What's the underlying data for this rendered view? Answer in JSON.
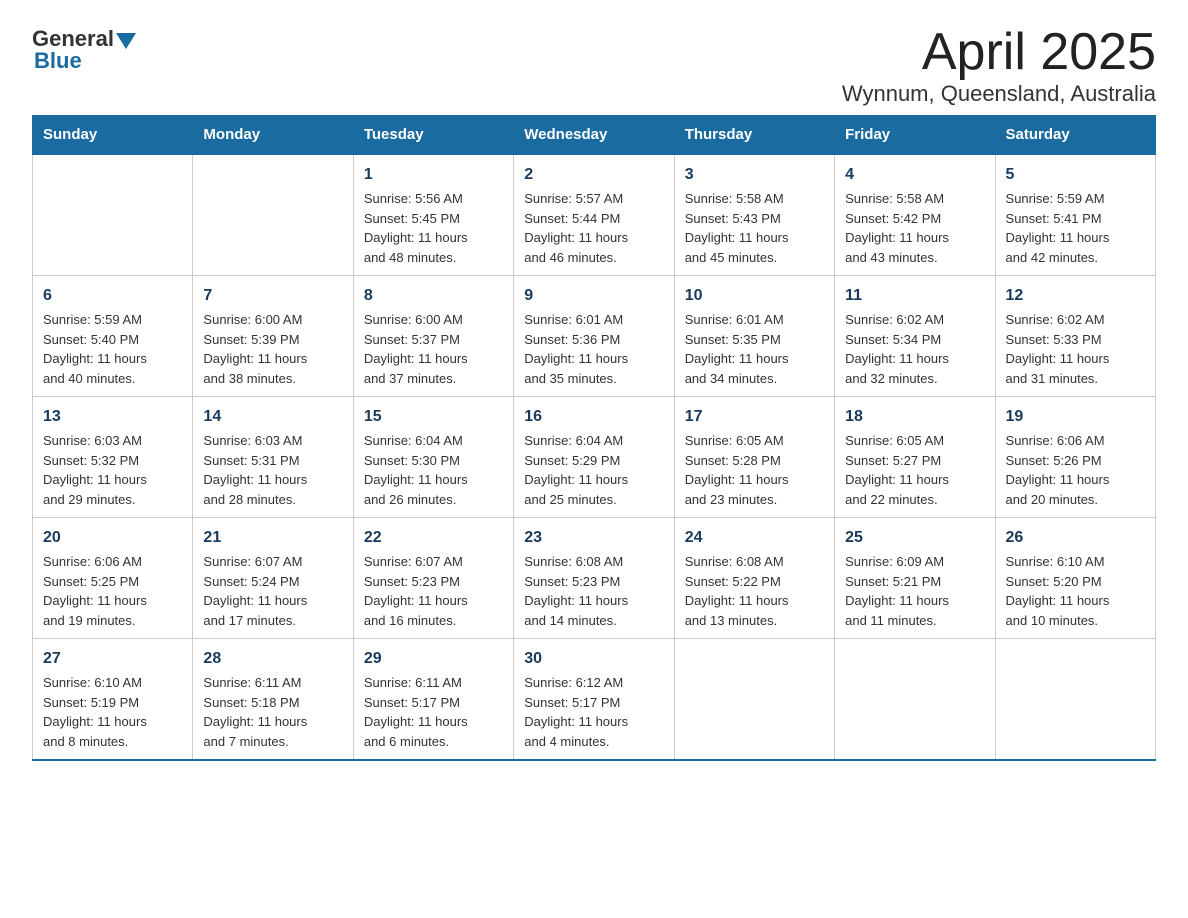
{
  "header": {
    "logo_general": "General",
    "logo_blue": "Blue",
    "title": "April 2025",
    "subtitle": "Wynnum, Queensland, Australia"
  },
  "days_of_week": [
    "Sunday",
    "Monday",
    "Tuesday",
    "Wednesday",
    "Thursday",
    "Friday",
    "Saturday"
  ],
  "weeks": [
    [
      {
        "day": "",
        "info": ""
      },
      {
        "day": "",
        "info": ""
      },
      {
        "day": "1",
        "info": "Sunrise: 5:56 AM\nSunset: 5:45 PM\nDaylight: 11 hours\nand 48 minutes."
      },
      {
        "day": "2",
        "info": "Sunrise: 5:57 AM\nSunset: 5:44 PM\nDaylight: 11 hours\nand 46 minutes."
      },
      {
        "day": "3",
        "info": "Sunrise: 5:58 AM\nSunset: 5:43 PM\nDaylight: 11 hours\nand 45 minutes."
      },
      {
        "day": "4",
        "info": "Sunrise: 5:58 AM\nSunset: 5:42 PM\nDaylight: 11 hours\nand 43 minutes."
      },
      {
        "day": "5",
        "info": "Sunrise: 5:59 AM\nSunset: 5:41 PM\nDaylight: 11 hours\nand 42 minutes."
      }
    ],
    [
      {
        "day": "6",
        "info": "Sunrise: 5:59 AM\nSunset: 5:40 PM\nDaylight: 11 hours\nand 40 minutes."
      },
      {
        "day": "7",
        "info": "Sunrise: 6:00 AM\nSunset: 5:39 PM\nDaylight: 11 hours\nand 38 minutes."
      },
      {
        "day": "8",
        "info": "Sunrise: 6:00 AM\nSunset: 5:37 PM\nDaylight: 11 hours\nand 37 minutes."
      },
      {
        "day": "9",
        "info": "Sunrise: 6:01 AM\nSunset: 5:36 PM\nDaylight: 11 hours\nand 35 minutes."
      },
      {
        "day": "10",
        "info": "Sunrise: 6:01 AM\nSunset: 5:35 PM\nDaylight: 11 hours\nand 34 minutes."
      },
      {
        "day": "11",
        "info": "Sunrise: 6:02 AM\nSunset: 5:34 PM\nDaylight: 11 hours\nand 32 minutes."
      },
      {
        "day": "12",
        "info": "Sunrise: 6:02 AM\nSunset: 5:33 PM\nDaylight: 11 hours\nand 31 minutes."
      }
    ],
    [
      {
        "day": "13",
        "info": "Sunrise: 6:03 AM\nSunset: 5:32 PM\nDaylight: 11 hours\nand 29 minutes."
      },
      {
        "day": "14",
        "info": "Sunrise: 6:03 AM\nSunset: 5:31 PM\nDaylight: 11 hours\nand 28 minutes."
      },
      {
        "day": "15",
        "info": "Sunrise: 6:04 AM\nSunset: 5:30 PM\nDaylight: 11 hours\nand 26 minutes."
      },
      {
        "day": "16",
        "info": "Sunrise: 6:04 AM\nSunset: 5:29 PM\nDaylight: 11 hours\nand 25 minutes."
      },
      {
        "day": "17",
        "info": "Sunrise: 6:05 AM\nSunset: 5:28 PM\nDaylight: 11 hours\nand 23 minutes."
      },
      {
        "day": "18",
        "info": "Sunrise: 6:05 AM\nSunset: 5:27 PM\nDaylight: 11 hours\nand 22 minutes."
      },
      {
        "day": "19",
        "info": "Sunrise: 6:06 AM\nSunset: 5:26 PM\nDaylight: 11 hours\nand 20 minutes."
      }
    ],
    [
      {
        "day": "20",
        "info": "Sunrise: 6:06 AM\nSunset: 5:25 PM\nDaylight: 11 hours\nand 19 minutes."
      },
      {
        "day": "21",
        "info": "Sunrise: 6:07 AM\nSunset: 5:24 PM\nDaylight: 11 hours\nand 17 minutes."
      },
      {
        "day": "22",
        "info": "Sunrise: 6:07 AM\nSunset: 5:23 PM\nDaylight: 11 hours\nand 16 minutes."
      },
      {
        "day": "23",
        "info": "Sunrise: 6:08 AM\nSunset: 5:23 PM\nDaylight: 11 hours\nand 14 minutes."
      },
      {
        "day": "24",
        "info": "Sunrise: 6:08 AM\nSunset: 5:22 PM\nDaylight: 11 hours\nand 13 minutes."
      },
      {
        "day": "25",
        "info": "Sunrise: 6:09 AM\nSunset: 5:21 PM\nDaylight: 11 hours\nand 11 minutes."
      },
      {
        "day": "26",
        "info": "Sunrise: 6:10 AM\nSunset: 5:20 PM\nDaylight: 11 hours\nand 10 minutes."
      }
    ],
    [
      {
        "day": "27",
        "info": "Sunrise: 6:10 AM\nSunset: 5:19 PM\nDaylight: 11 hours\nand 8 minutes."
      },
      {
        "day": "28",
        "info": "Sunrise: 6:11 AM\nSunset: 5:18 PM\nDaylight: 11 hours\nand 7 minutes."
      },
      {
        "day": "29",
        "info": "Sunrise: 6:11 AM\nSunset: 5:17 PM\nDaylight: 11 hours\nand 6 minutes."
      },
      {
        "day": "30",
        "info": "Sunrise: 6:12 AM\nSunset: 5:17 PM\nDaylight: 11 hours\nand 4 minutes."
      },
      {
        "day": "",
        "info": ""
      },
      {
        "day": "",
        "info": ""
      },
      {
        "day": "",
        "info": ""
      }
    ]
  ]
}
